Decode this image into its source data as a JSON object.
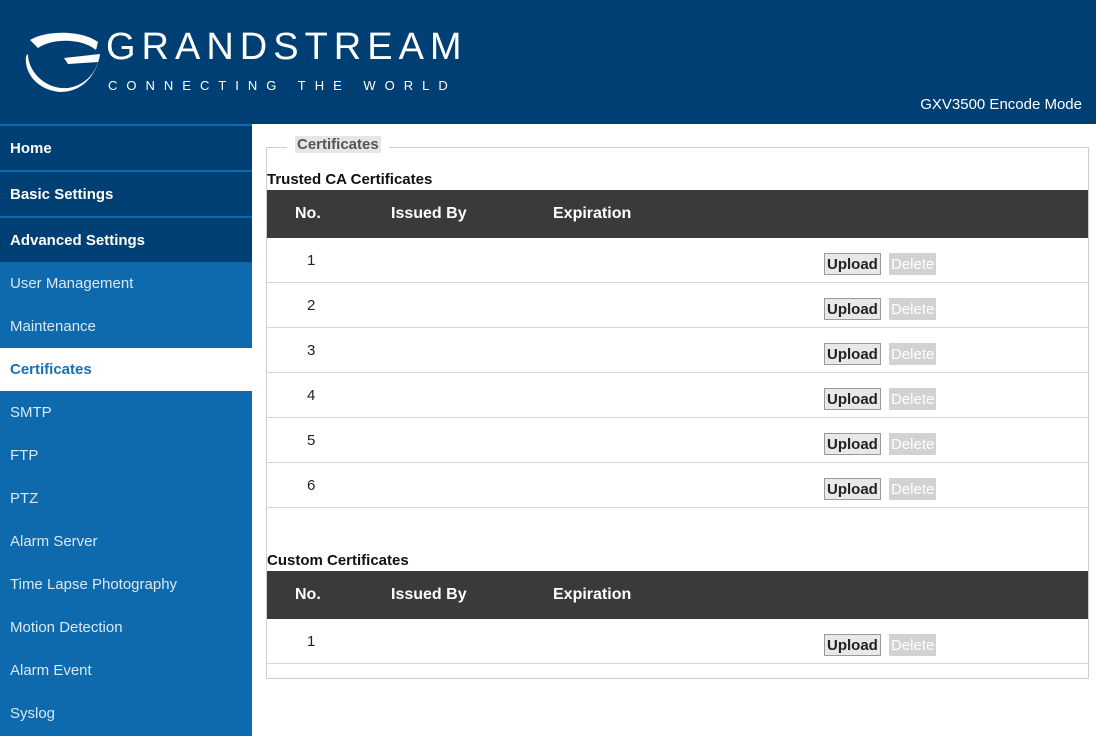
{
  "header": {
    "brand": "GRANDSTREAM",
    "tagline": "CONNECTING THE WORLD",
    "mode": "GXV3500 Encode Mode",
    "colors": {
      "header_bg": "#003f73",
      "sidebar_bg": "#0f6aad",
      "active_text": "#1a6fb5"
    }
  },
  "sidebar": {
    "top_items": [
      {
        "label": "Home"
      },
      {
        "label": "Basic Settings"
      },
      {
        "label": "Advanced Settings"
      }
    ],
    "items": [
      {
        "label": "User Management"
      },
      {
        "label": "Maintenance"
      },
      {
        "label": "Certificates",
        "active": true
      },
      {
        "label": "SMTP"
      },
      {
        "label": "FTP"
      },
      {
        "label": "PTZ"
      },
      {
        "label": "Alarm Server"
      },
      {
        "label": "Time Lapse Photography"
      },
      {
        "label": "Motion Detection"
      },
      {
        "label": "Alarm Event"
      },
      {
        "label": "Syslog"
      }
    ]
  },
  "main": {
    "legend": "Certificates",
    "trusted": {
      "title": "Trusted CA Certificates",
      "columns": [
        "No.",
        "Issued By",
        "Expiration"
      ],
      "rows": [
        {
          "no": "1",
          "upload": "Upload",
          "delete": "Delete"
        },
        {
          "no": "2",
          "upload": "Upload",
          "delete": "Delete"
        },
        {
          "no": "3",
          "upload": "Upload",
          "delete": "Delete"
        },
        {
          "no": "4",
          "upload": "Upload",
          "delete": "Delete"
        },
        {
          "no": "5",
          "upload": "Upload",
          "delete": "Delete"
        },
        {
          "no": "6",
          "upload": "Upload",
          "delete": "Delete"
        }
      ]
    },
    "custom": {
      "title": "Custom Certificates",
      "columns": [
        "No.",
        "Issued By",
        "Expiration"
      ],
      "rows": [
        {
          "no": "1",
          "upload": "Upload",
          "delete": "Delete"
        }
      ]
    }
  }
}
